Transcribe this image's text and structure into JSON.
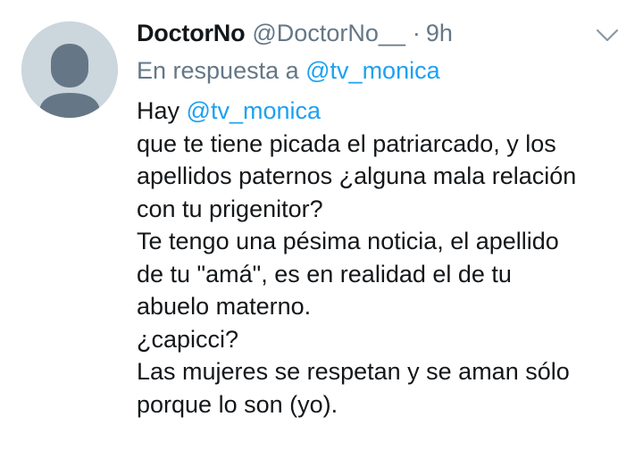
{
  "tweet": {
    "display_name": "DoctorNo",
    "handle": "@DoctorNo__",
    "separator": "·",
    "time": "9h",
    "reply_prefix": "En respuesta a",
    "reply_mention": "@tv_monica",
    "body_first_word": "Hay",
    "body_mention": "@tv_monica",
    "lines": [
      "que te tiene picada el patriarcado, y los",
      "apellidos paternos ¿alguna mala relación",
      "con tu prigenitor?",
      "Te tengo una pésima noticia, el apellido",
      "de tu \"amá\", es en realidad el de tu",
      "abuelo materno.",
      "¿capicci?",
      "Las mujeres se respetan y se aman sólo",
      "porque lo son (yo)."
    ]
  },
  "icons": {
    "avatar": "default-avatar-icon",
    "menu": "chevron-down-icon"
  },
  "colors": {
    "text": "#14171a",
    "secondary": "#657786",
    "link": "#1da1f2",
    "avatar_bg": "#ccd6dd",
    "avatar_fg": "#657786"
  }
}
